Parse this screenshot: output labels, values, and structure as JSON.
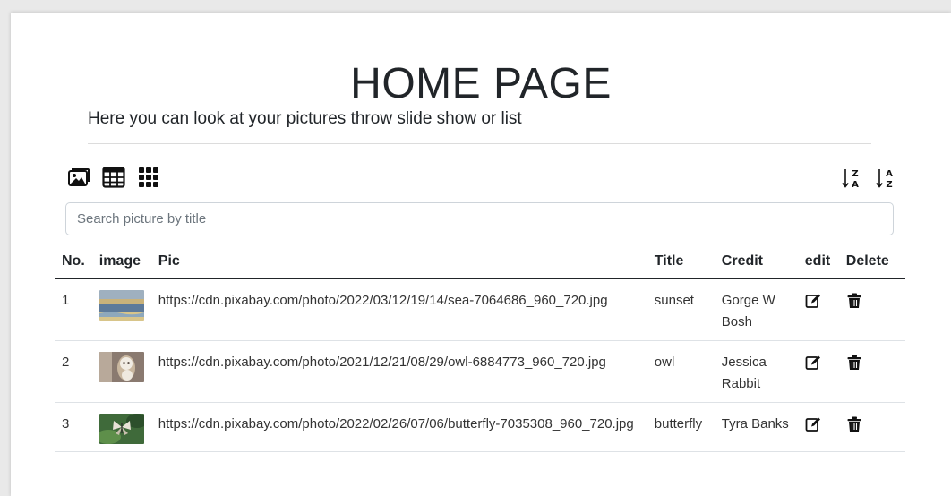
{
  "page": {
    "title": "HOME PAGE",
    "subtitle": "Here you can look at your pictures throw slide show or list"
  },
  "toolbar": {
    "view_icons": [
      "slideshow-icon",
      "table-view-icon",
      "grid-view-icon"
    ],
    "sort_icons": [
      "sort-z-a-icon",
      "sort-a-z-icon"
    ]
  },
  "search": {
    "placeholder": "Search picture by title",
    "value": ""
  },
  "table": {
    "headers": {
      "no": "No.",
      "image": "image",
      "pic": "Pic",
      "title": "Title",
      "credit": "Credit",
      "edit": "edit",
      "delete": "Delete"
    },
    "rows": [
      {
        "no": "1",
        "pic": "https://cdn.pixabay.com/photo/2022/03/12/19/14/sea-7064686_960_720.jpg",
        "title": "sunset",
        "credit": "Gorge W Bosh",
        "thumb": "sea"
      },
      {
        "no": "2",
        "pic": "https://cdn.pixabay.com/photo/2021/12/21/08/29/owl-6884773_960_720.jpg",
        "title": "owl",
        "credit": "Jessica Rabbit",
        "thumb": "owl"
      },
      {
        "no": "3",
        "pic": "https://cdn.pixabay.com/photo/2022/02/26/07/06/butterfly-7035308_960_720.jpg",
        "title": "butterfly",
        "credit": "Tyra Banks",
        "thumb": "butterfly"
      }
    ],
    "row_icons": {
      "edit": "edit-icon",
      "delete": "trash-icon"
    }
  }
}
